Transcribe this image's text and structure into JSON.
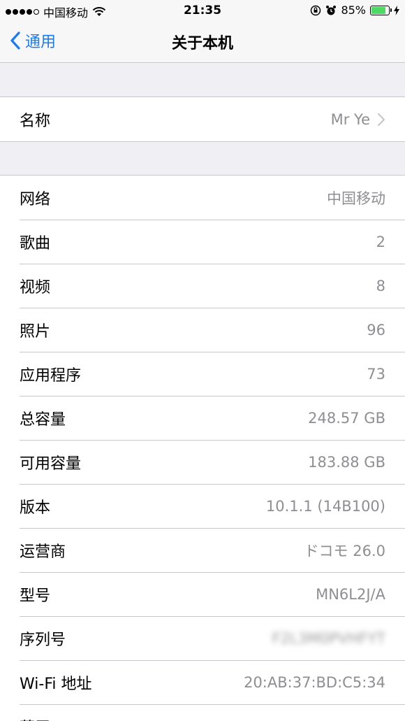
{
  "status_bar": {
    "carrier": "中国移动",
    "time": "21:35",
    "battery_percent": "85%",
    "battery_level": 0.85
  },
  "nav": {
    "back_label": "通用",
    "title": "关于本机"
  },
  "name_row": {
    "label": "名称",
    "value": "Mr Ye"
  },
  "info_rows": [
    {
      "label": "网络",
      "value": "中国移动"
    },
    {
      "label": "歌曲",
      "value": "2"
    },
    {
      "label": "视频",
      "value": "8"
    },
    {
      "label": "照片",
      "value": "96"
    },
    {
      "label": "应用程序",
      "value": "73"
    },
    {
      "label": "总容量",
      "value": "248.57 GB"
    },
    {
      "label": "可用容量",
      "value": "183.88 GB"
    },
    {
      "label": "版本",
      "value": "10.1.1 (14B100)"
    },
    {
      "label": "运营商",
      "value": "ドコモ 26.0"
    },
    {
      "label": "型号",
      "value": "MN6L2J/A"
    },
    {
      "label": "序列号",
      "value": "F2L3M0PVHFYT"
    },
    {
      "label": "Wi-Fi 地址",
      "value": "20:AB:37:BD:C5:34"
    },
    {
      "label": "蓝牙",
      "value": ""
    }
  ]
}
